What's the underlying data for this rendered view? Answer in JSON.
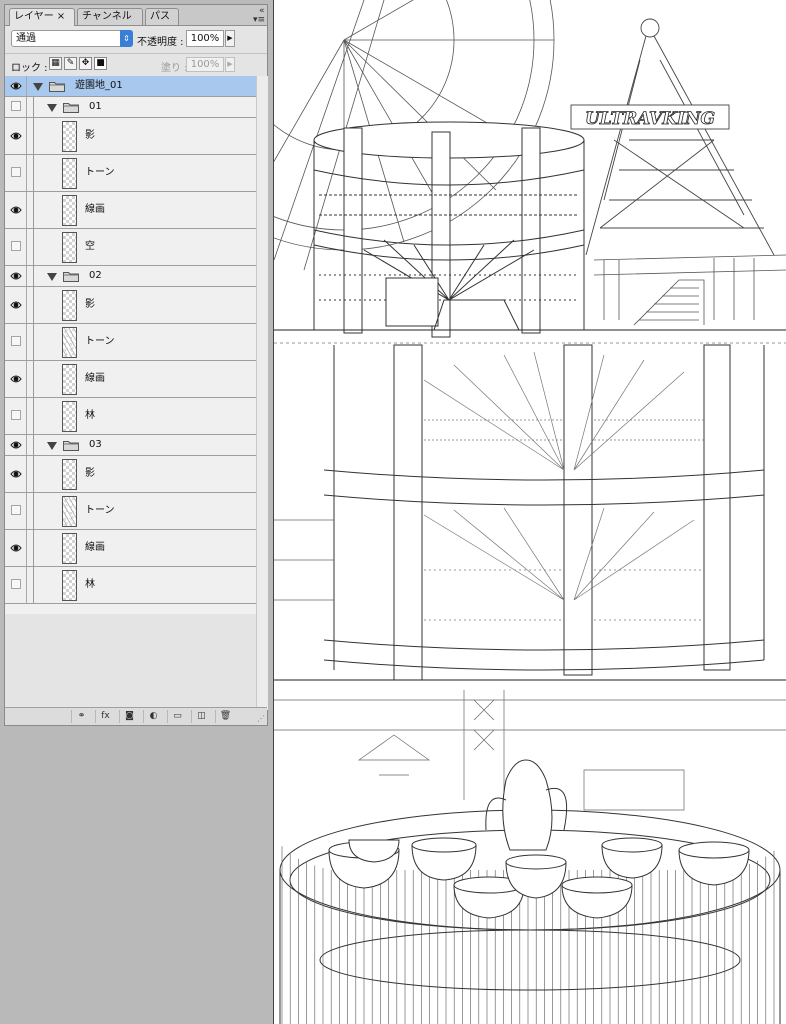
{
  "panel": {
    "tabs": [
      {
        "label": "レイヤー",
        "active": true,
        "closable": true
      },
      {
        "label": "チャンネル",
        "active": false
      },
      {
        "label": "パス",
        "active": false
      }
    ],
    "blend_mode": "通過",
    "opacity_label": "不透明度 :",
    "opacity_value": "100%",
    "lock_label": "ロック :",
    "fill_label": "塗り :",
    "fill_value": "100%"
  },
  "layers": [
    {
      "name": "遊園地_01",
      "kind": "group",
      "depth": 0,
      "visible": true,
      "selected": true,
      "expanded": true
    },
    {
      "name": "01",
      "kind": "group",
      "depth": 1,
      "visible": false,
      "expanded": true
    },
    {
      "name": "影",
      "kind": "layer",
      "depth": 2,
      "visible": true,
      "thumb": "blank"
    },
    {
      "name": "トーン",
      "kind": "layer",
      "depth": 2,
      "visible": false,
      "thumb": "blank"
    },
    {
      "name": "線画",
      "kind": "layer",
      "depth": 2,
      "visible": true,
      "thumb": "blank"
    },
    {
      "name": "空",
      "kind": "layer",
      "depth": 2,
      "visible": false,
      "thumb": "blank"
    },
    {
      "name": "02",
      "kind": "group",
      "depth": 1,
      "visible": true,
      "expanded": true
    },
    {
      "name": "影",
      "kind": "layer",
      "depth": 2,
      "visible": true,
      "thumb": "blank"
    },
    {
      "name": "トーン",
      "kind": "layer",
      "depth": 2,
      "visible": false,
      "thumb": "sketch"
    },
    {
      "name": "線画",
      "kind": "layer",
      "depth": 2,
      "visible": true,
      "thumb": "blank"
    },
    {
      "name": "林",
      "kind": "layer",
      "depth": 2,
      "visible": false,
      "thumb": "blank"
    },
    {
      "name": "03",
      "kind": "group",
      "depth": 1,
      "visible": true,
      "expanded": true
    },
    {
      "name": "影",
      "kind": "layer",
      "depth": 2,
      "visible": true,
      "thumb": "blank"
    },
    {
      "name": "トーン",
      "kind": "layer",
      "depth": 2,
      "visible": false,
      "thumb": "sketch"
    },
    {
      "name": "線画",
      "kind": "layer",
      "depth": 2,
      "visible": true,
      "thumb": "blank"
    },
    {
      "name": "林",
      "kind": "layer",
      "depth": 2,
      "visible": false,
      "thumb": "blank"
    }
  ],
  "bottom_bar_icons": [
    "link-icon",
    "fx-icon",
    "mask-icon",
    "adjustment-icon",
    "new-group-icon",
    "new-layer-icon",
    "trash-icon"
  ],
  "canvas": {
    "sign_text": "ULTRAVKING"
  },
  "colors": {
    "selection": "#a9c8ee",
    "blend_arrow": "#3b7ed8"
  }
}
